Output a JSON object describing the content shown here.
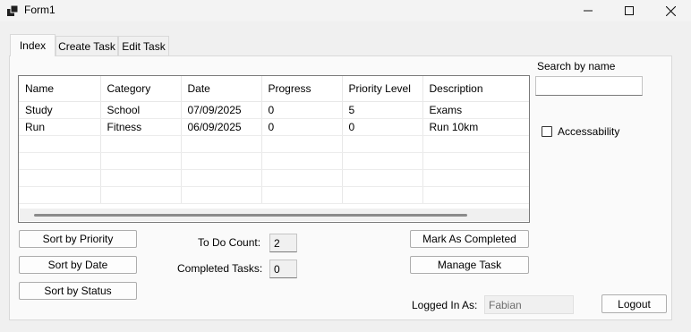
{
  "window": {
    "title": "Form1"
  },
  "tabs": [
    {
      "label": "Index"
    },
    {
      "label": "Create Task"
    },
    {
      "label": "Edit Task"
    }
  ],
  "grid": {
    "columns": [
      "Name",
      "Category",
      "Date",
      "Progress",
      "Priority Level",
      "Description"
    ],
    "rows": [
      [
        "Study",
        "School",
        "07/09/2025",
        "0",
        "5",
        "Exams"
      ],
      [
        "Run",
        "Fitness",
        "06/09/2025",
        "0",
        "0",
        "Run 10km"
      ]
    ]
  },
  "sort": {
    "priority_label": "Sort by Priority",
    "date_label": "Sort by Date",
    "status_label": "Sort by Status"
  },
  "counts": {
    "todo_label": "To Do Count:",
    "todo_value": "2",
    "completed_label": "Completed Tasks:",
    "completed_value": "0"
  },
  "actions": {
    "mark_completed_label": "Mark As Completed",
    "manage_task_label": "Manage Task"
  },
  "search": {
    "label": "Search by name",
    "value": ""
  },
  "accessibility": {
    "label": "Accessability",
    "checked": false
  },
  "session": {
    "logged_in_label": "Logged In As:",
    "user": "Fabian",
    "logout_label": "Logout"
  }
}
